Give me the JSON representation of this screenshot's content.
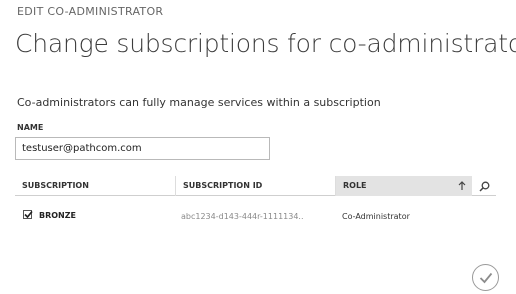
{
  "dialog": {
    "pre_title": "EDIT CO-ADMINISTRATOR",
    "title": "Change subscriptions for co-administrator",
    "description": "Co-administrators can fully manage services within a subscription"
  },
  "form": {
    "name_label": "NAME",
    "name_value": "testuser@pathcom.com"
  },
  "table": {
    "headers": {
      "subscription": "SUBSCRIPTION",
      "subscription_id": "SUBSCRIPTION ID",
      "role": "ROLE"
    },
    "sort_icon": "arrow-up-icon",
    "search_icon": "search-icon",
    "rows": [
      {
        "checked": true,
        "subscription": "BRONZE",
        "subscription_id": "abc1234-d143-444r-1111134..",
        "role": "Co-Administrator"
      }
    ]
  },
  "footer": {
    "ok_icon": "checkmark-icon"
  },
  "colors": {
    "sorted_header_bg": "#e3e3e3",
    "input_border": "#b9b9b9",
    "muted_text": "#8a8a8a"
  }
}
